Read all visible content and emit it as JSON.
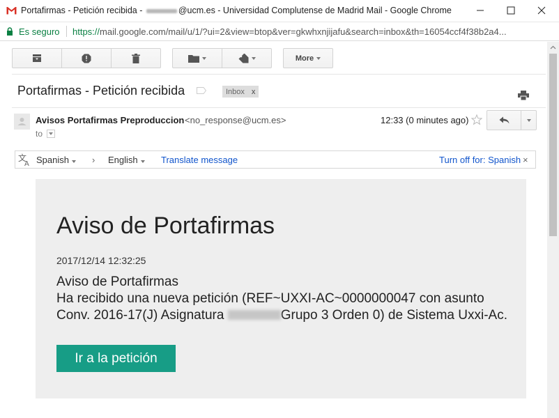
{
  "window": {
    "title_prefix": "Portafirmas - Petición recibida - ",
    "title_suffix": "@ucm.es - Universidad Complutense de Madrid Mail - Google Chrome"
  },
  "address_bar": {
    "secure_label": "Es seguro",
    "url_scheme": "https://",
    "url_rest": "mail.google.com/mail/u/1/?ui=2&view=btop&ver=gkwhxnjijafu&search=inbox&th=16054ccf4f38b2a4..."
  },
  "toolbar": {
    "more_label": "More"
  },
  "email": {
    "subject": "Portafirmas - Petición recibida",
    "label": "Inbox",
    "label_remove": "x",
    "sender_name": "Avisos Portafirmas Preproduccion",
    "sender_email": "<no_response@ucm.es>",
    "to": "to",
    "timestamp": "12:33 (0 minutes ago)"
  },
  "translate": {
    "from_lang": "Spanish",
    "arrow": "›",
    "to_lang": "English",
    "action": "Translate message",
    "turn_off": "Turn off for: Spanish",
    "close": "×"
  },
  "message": {
    "heading": "Aviso de Portafirmas",
    "date": "2017/12/14 12:32:25",
    "line1": "Aviso de Portafirmas",
    "line2_a": "Ha recibido una nueva petición (REF~UXXI-AC~0000000047 con asunto Conv. 2016-17(J) Asignatura",
    "line2_b": "Grupo 3 Orden 0) de Sistema Uxxi-Ac.",
    "button_label": "Ir a la petición"
  },
  "colors": {
    "accent": "#179d86",
    "link": "#1155cc",
    "secure": "#0b8043"
  }
}
